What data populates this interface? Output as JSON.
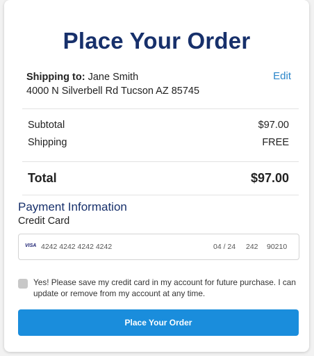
{
  "page": {
    "title": "Place Your Order"
  },
  "shipping": {
    "label": "Shipping to:",
    "name": "Jane Smith",
    "address": "4000 N Silverbell Rd Tucson AZ 85745",
    "edit_label": "Edit"
  },
  "summary": {
    "subtotal_label": "Subtotal",
    "subtotal_value": "$97.00",
    "shipping_label": "Shipping",
    "shipping_value": "FREE",
    "total_label": "Total",
    "total_value": "$97.00"
  },
  "payment": {
    "title": "Payment Information",
    "method_label": "Credit Card",
    "card_brand": "VISA",
    "card_number": "4242 4242 4242 4242",
    "expiry": "04 / 24",
    "cvc": "242",
    "zip": "90210",
    "save_card_text": "Yes! Please save my credit card in my account for future purchase. I can update or remove from my account at any time."
  },
  "actions": {
    "place_order_label": "Place Your Order"
  },
  "colors": {
    "title": "#17306b",
    "link": "#2b86c9",
    "button": "#1a8ddc"
  }
}
